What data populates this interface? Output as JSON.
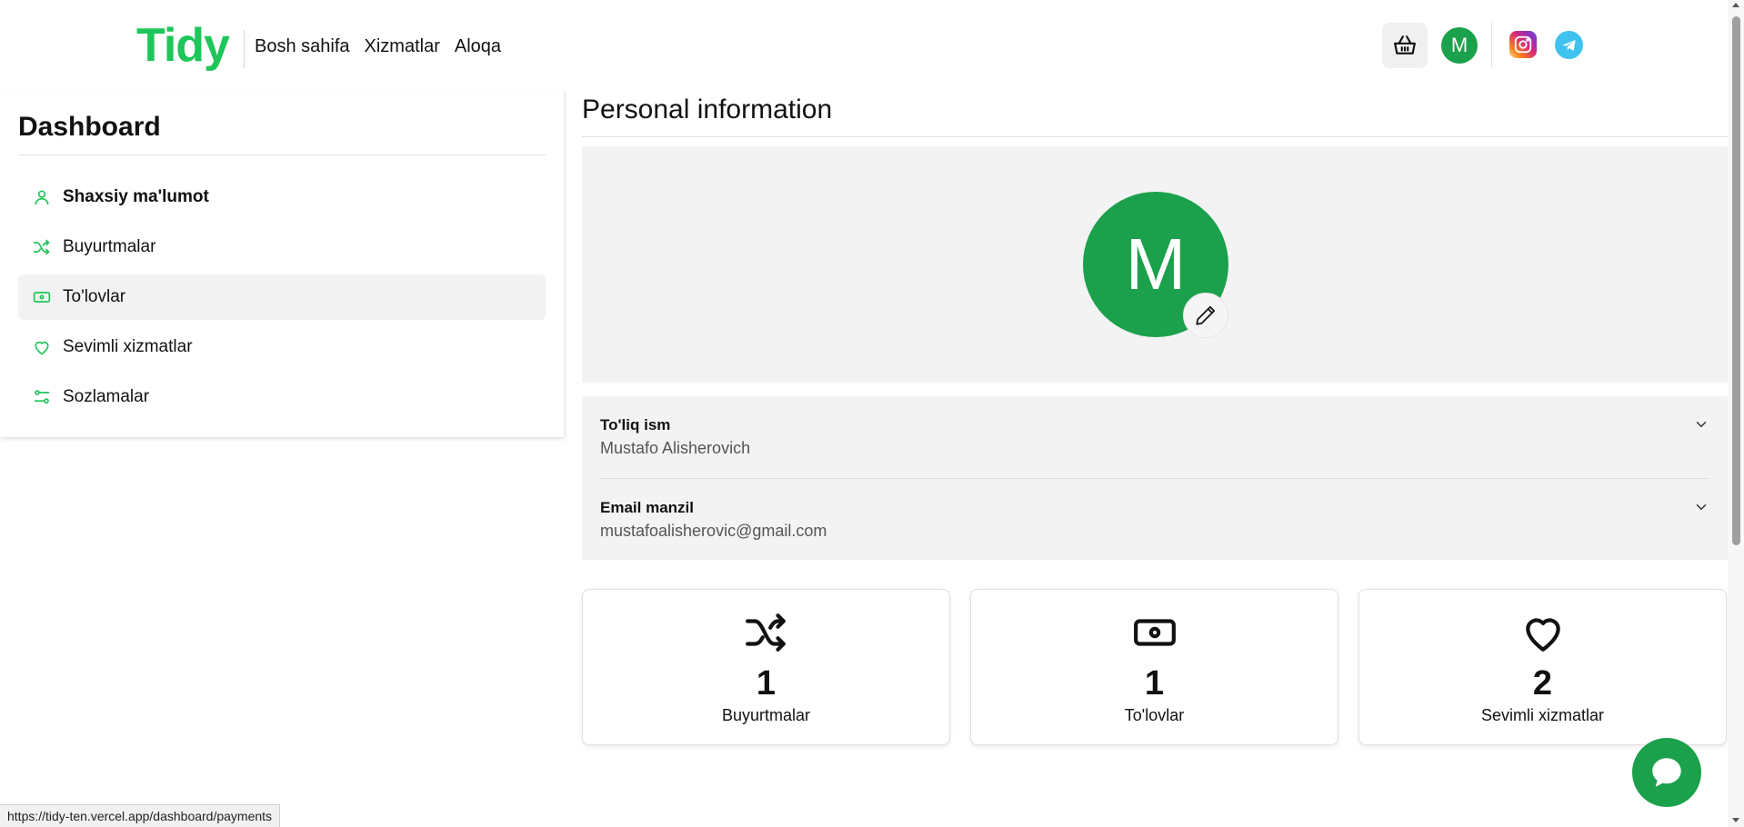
{
  "header": {
    "logo": "Tidy",
    "nav": [
      "Bosh sahifa",
      "Xizmatlar",
      "Aloqa"
    ],
    "avatar_initial": "M",
    "icons": [
      "basket-icon",
      "instagram-icon",
      "telegram-icon"
    ]
  },
  "sidebar": {
    "title": "Dashboard",
    "items": [
      {
        "label": "Shaxsiy ma'lumot",
        "icon": "user-icon"
      },
      {
        "label": "Buyurtmalar",
        "icon": "shuffle-icon"
      },
      {
        "label": "To'lovlar",
        "icon": "banknote-icon"
      },
      {
        "label": "Sevimli xizmatlar",
        "icon": "heart-icon"
      },
      {
        "label": "Sozlamalar",
        "icon": "settings-sliders-icon"
      }
    ]
  },
  "main": {
    "title": "Personal information",
    "avatar_initial": "M",
    "fields": [
      {
        "label": "To'liq ism",
        "value": "Mustafo Alisherovich"
      },
      {
        "label": "Email manzil",
        "value": "mustafoalisherovic@gmail.com"
      }
    ],
    "stats": [
      {
        "value": "1",
        "label": "Buyurtmalar",
        "icon": "shuffle-icon"
      },
      {
        "value": "1",
        "label": "To'lovlar",
        "icon": "banknote-icon"
      },
      {
        "value": "2",
        "label": "Sevimli xizmatlar",
        "icon": "heart-icon"
      }
    ]
  },
  "status_bar": {
    "url": "https://tidy-ten.vercel.app/dashboard/payments"
  },
  "colors": {
    "brand_green": "#1ec65a",
    "avatar_green": "#1ba14b",
    "panel_gray": "#f3f3f3"
  }
}
